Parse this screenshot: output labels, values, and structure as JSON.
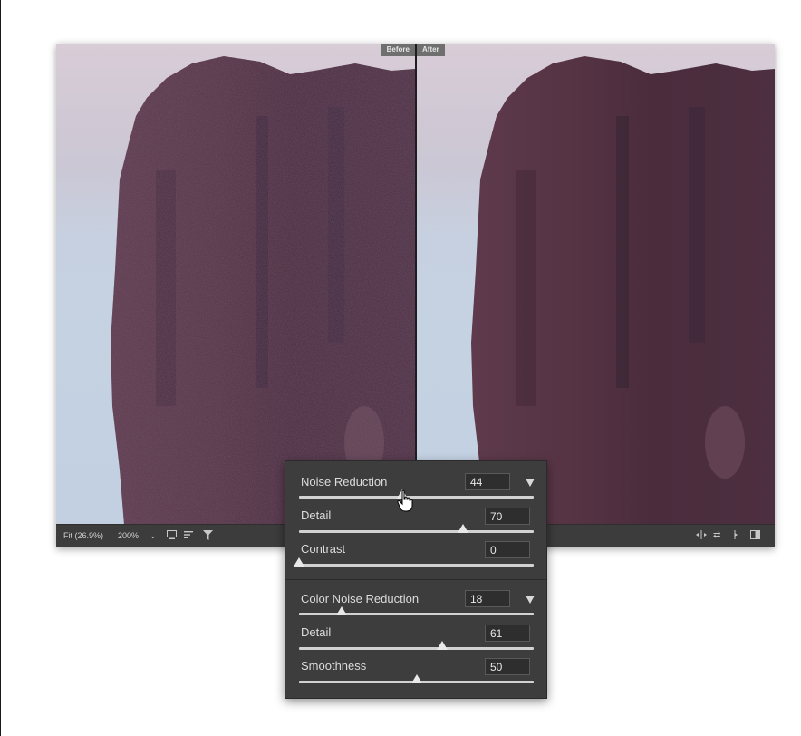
{
  "preview": {
    "before_label": "Before",
    "after_label": "After",
    "status": {
      "fit": "Fit (26.9%)",
      "zoom": "200%",
      "zoom_caret": "⌄"
    }
  },
  "noise_panel": {
    "luminance": {
      "label": "Noise Reduction",
      "value": "44",
      "level_pct": 44,
      "detail_label": "Detail",
      "detail_value": "70",
      "detail_pct": 70,
      "contrast_label": "Contrast",
      "contrast_value": "0",
      "contrast_pct": 0
    },
    "color": {
      "label": "Color Noise Reduction",
      "value": "18",
      "level_pct": 18,
      "detail_label": "Detail",
      "detail_value": "61",
      "detail_pct": 61,
      "smoothness_label": "Smoothness",
      "smoothness_value": "50",
      "smoothness_pct": 50
    }
  }
}
